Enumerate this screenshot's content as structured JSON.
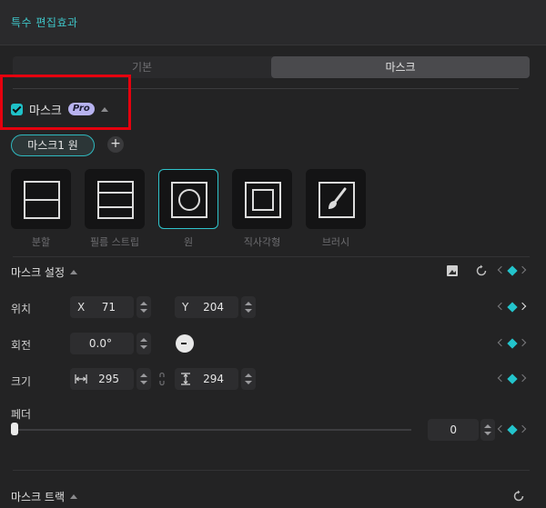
{
  "header": {
    "title": "특수 편집효과"
  },
  "tabs": [
    {
      "label": "기본",
      "active": false
    },
    {
      "label": "마스크",
      "active": true
    }
  ],
  "mask_toggle": {
    "checked": true,
    "label": "마스크",
    "badge": "Pro"
  },
  "mask_chip": {
    "label": "마스크1 원"
  },
  "add_button": {
    "label": "+"
  },
  "shapes": [
    {
      "label": "분할",
      "icon": "split-icon",
      "selected": false
    },
    {
      "label": "필름 스트립",
      "icon": "film-strip-icon",
      "selected": false
    },
    {
      "label": "원",
      "icon": "circle-icon",
      "selected": true
    },
    {
      "label": "직사각형",
      "icon": "rectangle-icon",
      "selected": false
    },
    {
      "label": "브러시",
      "icon": "brush-icon",
      "selected": false
    }
  ],
  "mask_settings": {
    "title": "마스크 설정",
    "position": {
      "label": "위치",
      "x_prefix": "X",
      "x": "71",
      "y_prefix": "Y",
      "y": "204"
    },
    "rotation": {
      "label": "회전",
      "value": "0.0°"
    },
    "size": {
      "label": "크기",
      "width": "295",
      "height": "294"
    },
    "feather": {
      "label": "페더",
      "value": "0",
      "level": 0
    }
  },
  "mask_tracking": {
    "title": "마스크 트랙"
  },
  "colors": {
    "accent": "#23c4cc",
    "highlight": "#e5000e",
    "pro_badge": "#b7b2ef"
  }
}
